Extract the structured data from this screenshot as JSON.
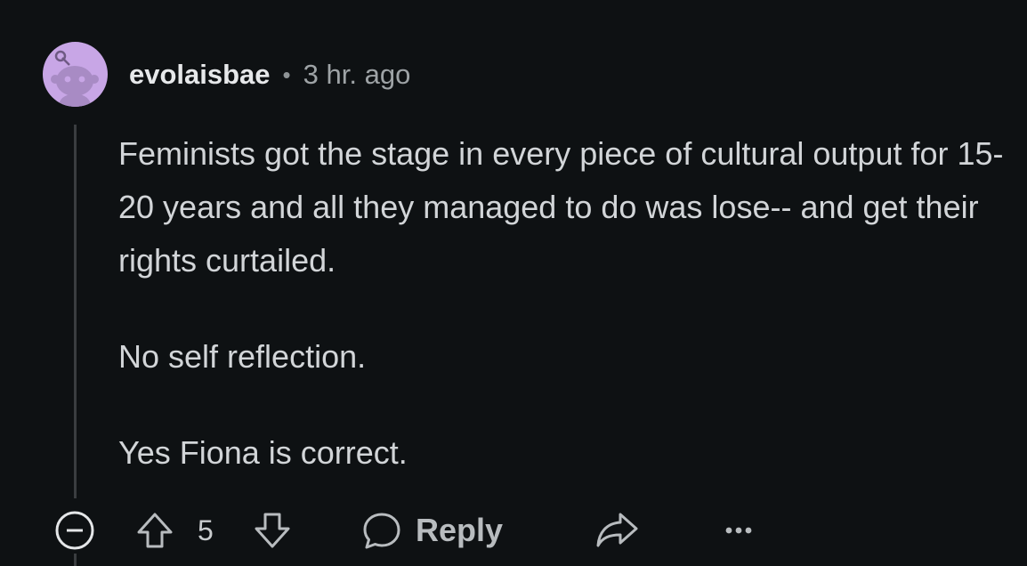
{
  "comment": {
    "username": "evolaisbae",
    "separator": "•",
    "timestamp": "3 hr. ago",
    "paragraphs": [
      "Feminists got the stage in every piece of cultural output for 15-20 years and all they managed to do was lose-- and get their rights curtailed.",
      "No self reflection.",
      "Yes Fiona is correct."
    ]
  },
  "actions": {
    "score": "5",
    "reply_label": "Reply"
  },
  "colors": {
    "background": "#0e1113",
    "avatar": "#c8a6e6",
    "text": "#d2d5d8",
    "muted": "#9ea3a6"
  },
  "icons": [
    "snoo-avatar-icon",
    "collapse-icon",
    "upvote-icon",
    "downvote-icon",
    "reply-bubble-icon",
    "share-icon",
    "more-options-icon"
  ]
}
